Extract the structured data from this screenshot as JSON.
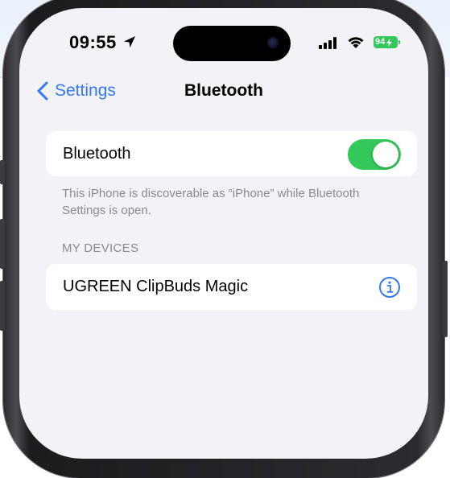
{
  "status_bar": {
    "time": "09:55",
    "battery_level": "94",
    "icons": [
      "location-arrow-icon",
      "cellular-signal-icon",
      "wifi-icon",
      "battery-charging-icon"
    ]
  },
  "nav": {
    "back_label": "Settings",
    "title": "Bluetooth"
  },
  "bluetooth_row": {
    "label": "Bluetooth",
    "toggle_on": true
  },
  "footnote": "This iPhone is discoverable as “iPhone” while Bluetooth Settings is open.",
  "devices_section": {
    "header": "MY DEVICES",
    "items": [
      {
        "name": "UGREEN ClipBuds Magic",
        "icon": "info-icon"
      }
    ]
  },
  "colors": {
    "accent": "#3478f6",
    "toggle_on": "#34c759",
    "background": "#f2f2f7",
    "secondary_text": "#8a8a8e"
  }
}
